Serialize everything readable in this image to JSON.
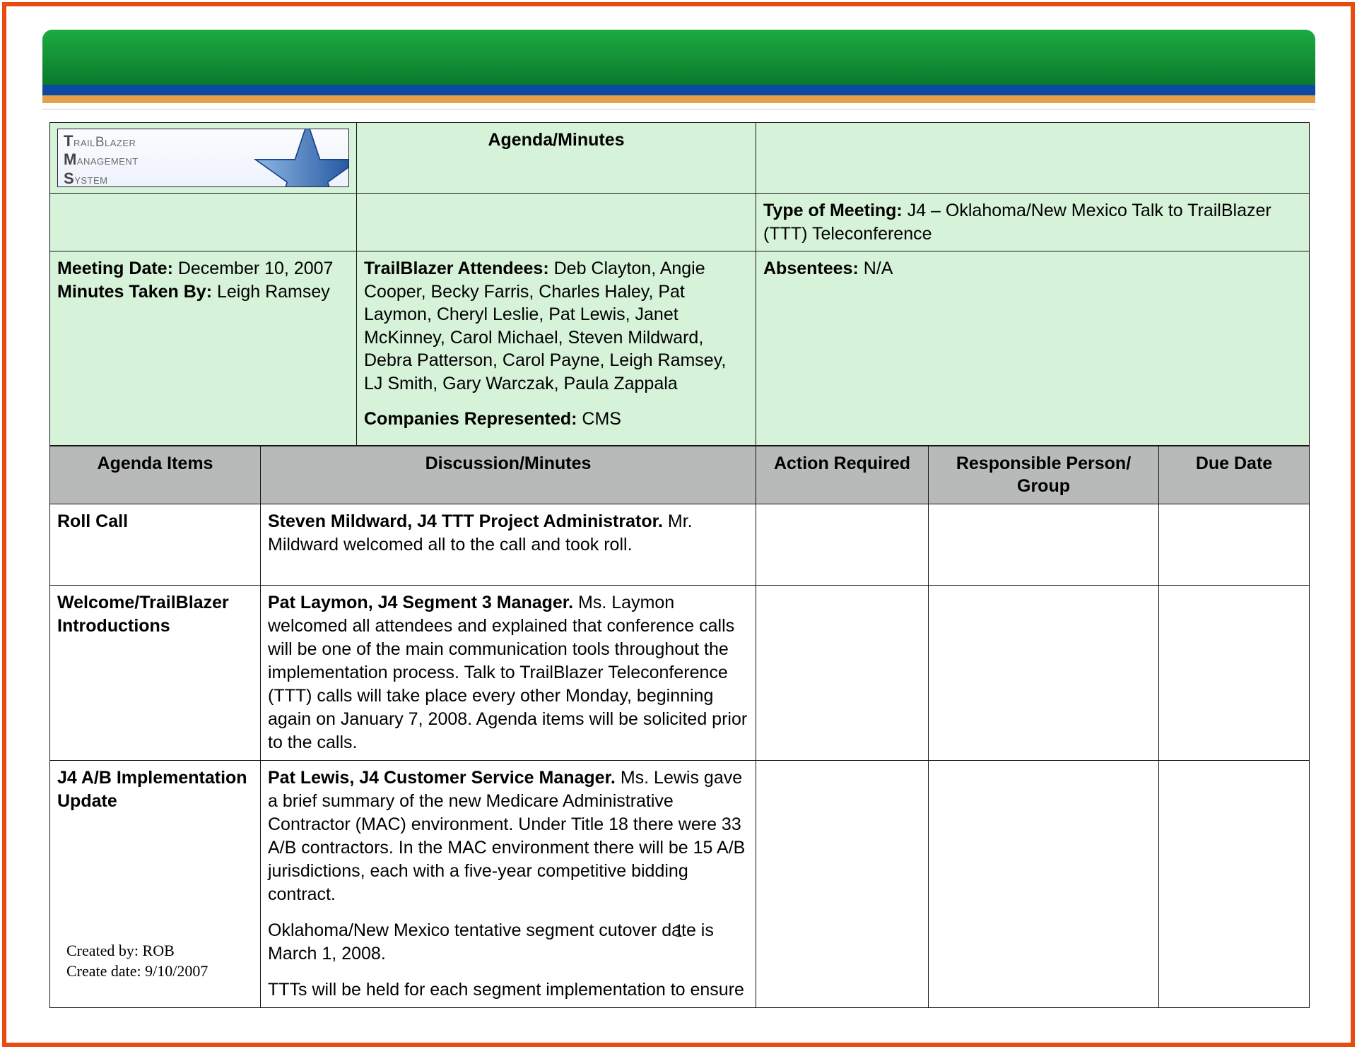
{
  "logo": {
    "line1_initial": "T",
    "line1_rest": "railBlazer",
    "line2_initial": "M",
    "line2_rest": "anagement",
    "line3_initial": "S",
    "line3_rest": "ystem"
  },
  "title": "Agenda/Minutes",
  "type_of_meeting_label": "Type of Meeting:",
  "type_of_meeting_value": " J4 – Oklahoma/New Mexico Talk to TrailBlazer (TTT) Teleconference",
  "meeting_date_label": "Meeting Date:",
  "meeting_date_value": " December 10, 2007",
  "minutes_by_label": "Minutes Taken By:",
  "minutes_by_value": " Leigh Ramsey",
  "attendees_label": "TrailBlazer Attendees:",
  "attendees_value": " Deb Clayton, Angie Cooper, Becky Farris, Charles Haley, Pat Laymon, Cheryl Leslie, Pat Lewis, Janet McKinney, Carol Michael, Steven Mildward, Debra Patterson, Carol Payne, Leigh Ramsey, LJ Smith, Gary Warczak, Paula Zappala",
  "companies_label": "Companies Represented:",
  "companies_value": " CMS",
  "absentees_label": "Absentees:",
  "absentees_value": " N/A",
  "columns": {
    "c0": "Agenda Items",
    "c1": "Discussion/Minutes",
    "c2": "Action Required",
    "c3": "Responsible Person/ Group",
    "c4": "Due Date"
  },
  "rows": [
    {
      "item": "Roll Call",
      "lead": "Steven Mildward, J4 TTT Project Administrator.",
      "text": " Mr. Mildward welcomed all to the call and took roll.",
      "action": "",
      "responsible": "",
      "due": ""
    },
    {
      "item": "Welcome/TrailBlazer Introductions",
      "lead": "Pat Laymon, J4 Segment 3 Manager.",
      "text": " Ms. Laymon welcomed all attendees and explained that conference calls will be one of the main communication tools throughout the implementation process. Talk to TrailBlazer Teleconference (TTT) calls will take place every other Monday, beginning again on January 7, 2008. Agenda items will be solicited prior to the calls.",
      "action": "",
      "responsible": "",
      "due": ""
    },
    {
      "item": "J4 A/B Implementation Update",
      "lead": "Pat Lewis, J4 Customer Service Manager.",
      "text": " Ms. Lewis gave a brief summary of the new Medicare Administrative Contractor (MAC) environment. Under Title 18 there were 33 A/B contractors. In the MAC environment there will be 15 A/B jurisdictions, each with a five-year competitive bidding contract.",
      "extra1": "Oklahoma/New Mexico tentative segment cutover date is March 1, 2008.",
      "extra2": "TTTs will be held for each segment implementation to ensure",
      "action": "",
      "responsible": "",
      "due": ""
    }
  ],
  "page_number": "1",
  "footer": {
    "created_by_label": "Created by:  ",
    "created_by_value": "ROB",
    "create_date_label": "Create date:  ",
    "create_date_value": "9/10/2007"
  }
}
